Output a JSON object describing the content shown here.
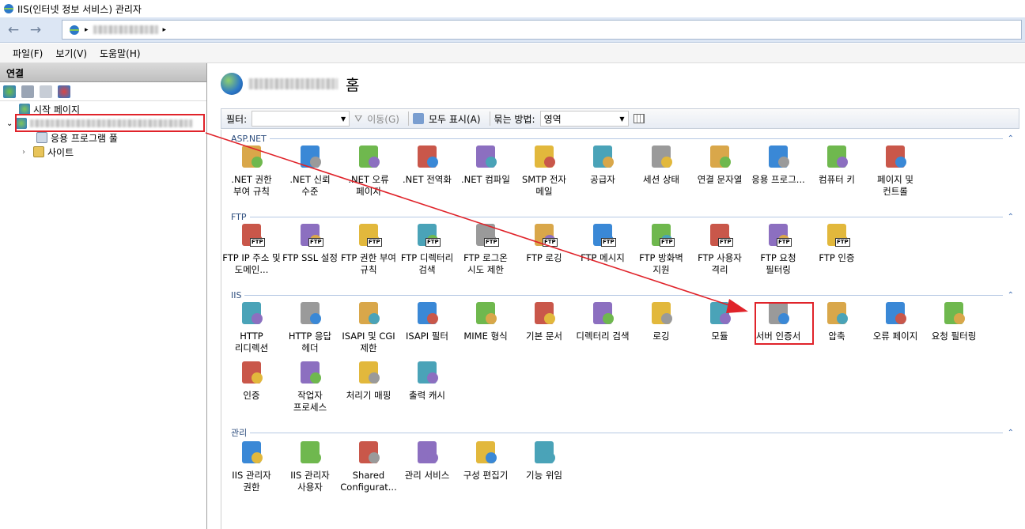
{
  "window": {
    "title": "IIS(인터넷 정보 서비스) 관리자"
  },
  "nav": {
    "back_icon": "back-arrow-icon",
    "forward_icon": "forward-arrow-icon",
    "crumb_sep": "▸"
  },
  "menu": {
    "file": "파일(F)",
    "view": "보기(V)",
    "help": "도움말(H)"
  },
  "connections": {
    "header": "연결",
    "start_page": "시작 페이지",
    "app_pools": "응용 프로그램 풀",
    "sites": "사이트"
  },
  "main": {
    "home_label": "홈",
    "filter_label": "필터:",
    "go_label": "이동(G)",
    "show_all_label": "모두 표시(A)",
    "group_by_label": "묶는 방법:",
    "group_by_value": "영역"
  },
  "groups": {
    "aspnet": "ASP.NET",
    "ftp": "FTP",
    "iis": "IIS",
    "mgmt": "관리"
  },
  "aspnet_items": [
    ".NET 권한 부여 규칙",
    ".NET 신뢰 수준",
    ".NET 오류 페이지",
    ".NET 전역화",
    ".NET 컴파일",
    "SMTP 전자 메일",
    "공급자",
    "세션 상태",
    "연결 문자열",
    "응용 프로그...",
    "컴퓨터 키",
    "페이지 및 컨트롤"
  ],
  "ftp_items": [
    "FTP IP 주소 및 도메인...",
    "FTP SSL 설정",
    "FTP 권한 부여 규칙",
    "FTP 디렉터리 검색",
    "FTP 로그온 시도 제한",
    "FTP 로깅",
    "FTP 메시지",
    "FTP 방화벽 지원",
    "FTP 사용자 격리",
    "FTP 요청 필터링",
    "FTP 인증"
  ],
  "iis_items": [
    "HTTP 리디렉션",
    "HTTP 응답 헤더",
    "ISAPI 및 CGI 제한",
    "ISAPI 필터",
    "MIME 형식",
    "기본 문서",
    "디렉터리 검색",
    "로깅",
    "모듈",
    "서버 인증서",
    "압축",
    "오류 페이지",
    "요청 필터링",
    "인증",
    "작업자 프로세스",
    "처리기 매핑",
    "출력 캐시"
  ],
  "mgmt_items": [
    "IIS 관리자 권한",
    "IIS 관리자 사용자",
    "Shared Configurat...",
    "관리 서비스",
    "구성 편집기",
    "기능 위임"
  ],
  "colors": {
    "highlight": "#e0232a",
    "accent": "#2f4f7f"
  }
}
